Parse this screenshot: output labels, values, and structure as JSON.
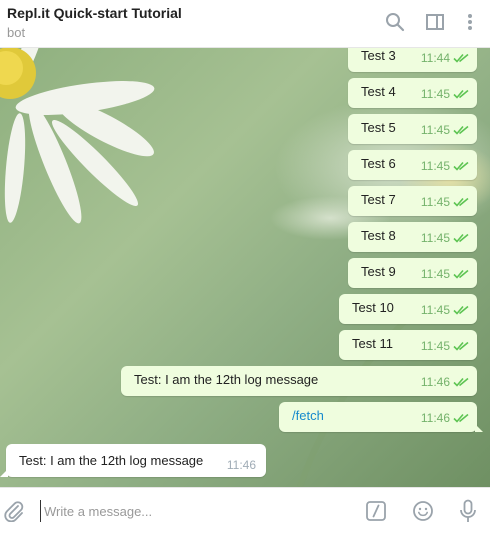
{
  "header": {
    "title": "Repl.it Quick-start Tutorial",
    "subtitle": "bot",
    "icons": [
      "search-icon",
      "sidebar-toggle-icon",
      "more-vert-icon"
    ]
  },
  "messages": [
    {
      "text": "Test 3",
      "time": "11:44"
    },
    {
      "text": "Test 4",
      "time": "11:45"
    },
    {
      "text": "Test 5",
      "time": "11:45"
    },
    {
      "text": "Test 6",
      "time": "11:45"
    },
    {
      "text": "Test 7",
      "time": "11:45"
    },
    {
      "text": "Test 8",
      "time": "11:45"
    },
    {
      "text": "Test 9",
      "time": "11:45"
    },
    {
      "text": "Test 10",
      "time": "11:45"
    },
    {
      "text": "Test 11",
      "time": "11:45"
    },
    {
      "text": "Test: I am the 12th log message",
      "time": "11:46"
    },
    {
      "text": "/fetch",
      "time": "11:46"
    }
  ],
  "incoming": {
    "text": "Test: I am the 12th log message",
    "time": "11:46"
  },
  "composer": {
    "placeholder": "Write a message...",
    "icons": [
      "attach-icon",
      "bot-command-icon",
      "emoji-icon",
      "microphone-icon"
    ]
  },
  "colors": {
    "outgoing_bubble": "#effdde",
    "incoming_bubble": "#ffffff",
    "read_ticks": "#5dc452",
    "link": "#168acd"
  }
}
